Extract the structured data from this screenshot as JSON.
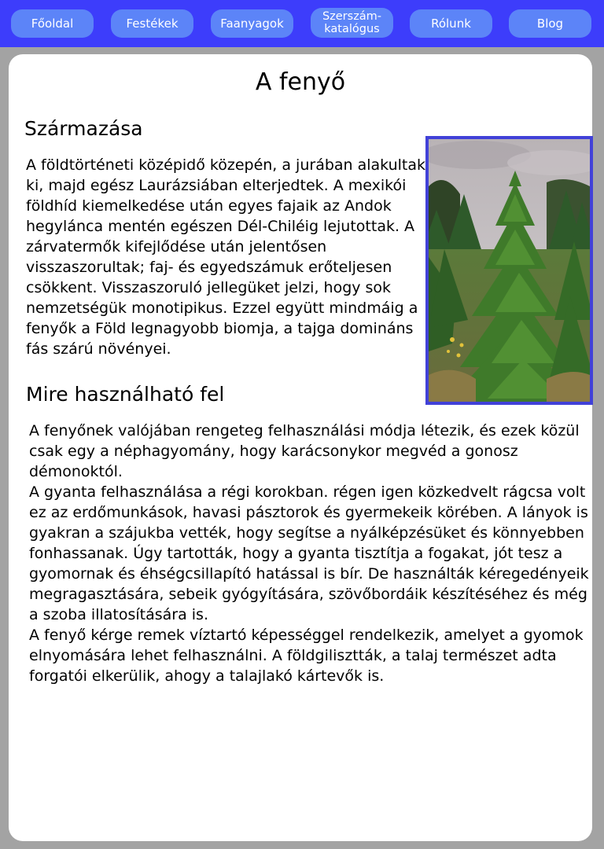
{
  "nav": {
    "items": [
      {
        "label": "Főoldal"
      },
      {
        "label": "Festékek"
      },
      {
        "label": "Faanyagok"
      },
      {
        "label": "Szerszám-\nkatalógus"
      },
      {
        "label": "Rólunk"
      },
      {
        "label": "Blog"
      }
    ]
  },
  "colors": {
    "navbar": "#3d3dfb",
    "nav_button": "#5c84f8",
    "photo_border": "#4141d8",
    "page_background": "#a3a3a3"
  },
  "article": {
    "title": "A fenyő",
    "origin_heading": "Származása",
    "origin_text": "A földtörténeti középidő közepén, a jurában alakultak ki, majd egész Laurázsiában elterjedtek. A mexikói földhíd kiemelkedése után egyes fajaik az Andok hegylánca mentén egészen Dél-Chiléig lejutottak. A zárvatermők kifejlődése után jelentősen visszaszorultak; faj- és egyedszámuk erőteljesen csökkent. Visszaszoruló jellegüket jelzi, hogy sok nemzetségük monotipikus. Ezzel együtt mindmáig a fenyők a Föld legnagyobb biomja, a tajga domináns fás szárú növényei.",
    "use_heading": "Mire használható fel",
    "use_paragraphs": [
      "A fenyőnek valójában rengeteg felhasználási módja létezik, és ezek közül csak egy a néphagyomány, hogy karácsonykor megvéd a gonosz démonoktól.",
      "A gyanta felhasználása a régi korokban. régen igen közkedvelt rágcsa volt ez az erdőmunkások, havasi pásztorok és gyermekeik körében. A lányok is gyakran a szájukba vették, hogy segítse a nyálképzésüket és könnyebben fonhassanak. Úgy tartották, hogy a gyanta tisztítja a fogakat, jót tesz a gyomornak és éhségcsillapító hatással is bír. De használták kéregedényeik megragasztására, sebeik gyógyítására, szövőbordáik készítéséhez és még a szoba illatosítására is.",
      "A fenyő kérge remek víztartó képességgel rendelkezik, amelyet a gyomok elnyomására lehet felhasználni. A földgilisztták, a talaj természet adta forgatói elkerülik, ahogy a talajlakó  kártevők is."
    ]
  }
}
